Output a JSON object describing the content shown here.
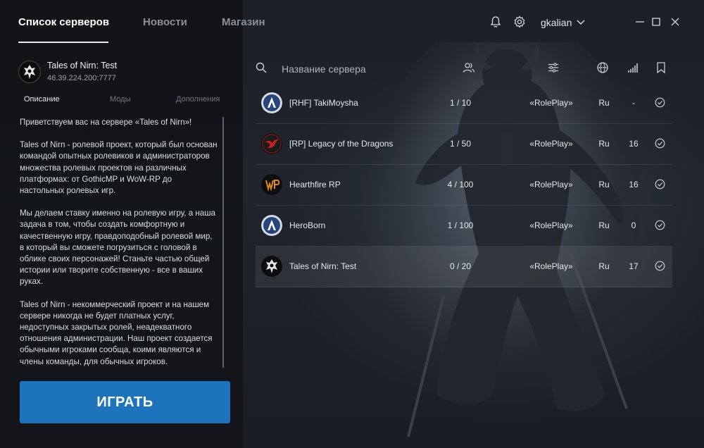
{
  "nav": {
    "tabs": [
      {
        "label": "Список серверов",
        "active": true
      },
      {
        "label": "Новости",
        "active": false
      },
      {
        "label": "Магазин",
        "active": false
      }
    ],
    "username": "gkalian",
    "icons": [
      "bell-icon",
      "gear-icon",
      "chevron-down-icon",
      "minimize-icon",
      "maximize-icon",
      "close-icon"
    ]
  },
  "selected_server": {
    "name": "Tales of Nirn: Test",
    "ip": "46.39.224.200:7777",
    "tabs": [
      "Описание",
      "Моды",
      "Дополнения"
    ],
    "active_tab": "Описание",
    "description": [
      "Приветствуем вас на сервере «Tales of Nirn»!",
      "Tales of Nirn - ролевой проект, который был основан командой опытных ролевиков и администраторов множества ролевых проектов на различных платформах: от GothicMP и WoW-RP до настольных ролевых игр.",
      "Мы делаем ставку именно на ролевую игру, а наша задача в том, чтобы создать комфортную и качественную игру, правдоподобный ролевой мир, в который вы сможете погрузиться с головой в облике своих персонажей! Станьте частью общей истории или творите собственную - все в ваших руках.",
      "Tales of Nirn - некоммерческий проект и на нашем сервере никогда не будет платных услуг, недоступных закрытых ролей, неадекватного отношения администрации. Наш проект создается обычными игроками сообща, коими являются и члены команды, для обычных игроков."
    ],
    "play_label": "ИГРАТЬ"
  },
  "server_list": {
    "search_placeholder": "Название сервера",
    "header_icons": [
      "search-icon",
      "players-icon",
      "filter-icon",
      "globe-icon",
      "signal-icon",
      "bookmark-icon"
    ],
    "rows": [
      {
        "name": "[RHF] TakiMoysha",
        "players": "1 / 10",
        "mode": "«RolePlay»",
        "lang": "Ru",
        "ping": "-",
        "logo": "blue",
        "selected": false
      },
      {
        "name": "[RP] Legacy of the Dragons",
        "players": "1 / 50",
        "mode": "«RolePlay»",
        "lang": "Ru",
        "ping": "16",
        "logo": "red",
        "selected": false
      },
      {
        "name": "Hearthfire RP",
        "players": "4 / 100",
        "mode": "«RolePlay»",
        "lang": "Ru",
        "ping": "16",
        "logo": "orange",
        "selected": false
      },
      {
        "name": "HeroBorn",
        "players": "1 / 100",
        "mode": "«RolePlay»",
        "lang": "Ru",
        "ping": "0",
        "logo": "blue",
        "selected": false
      },
      {
        "name": "Tales of Nirn: Test",
        "players": "0 / 20",
        "mode": "«RolePlay»",
        "lang": "Ru",
        "ping": "17",
        "logo": "dark",
        "selected": true
      }
    ]
  },
  "colors": {
    "accent": "#1d74bd",
    "background": "#14171c",
    "text": "#d7dbe2"
  }
}
